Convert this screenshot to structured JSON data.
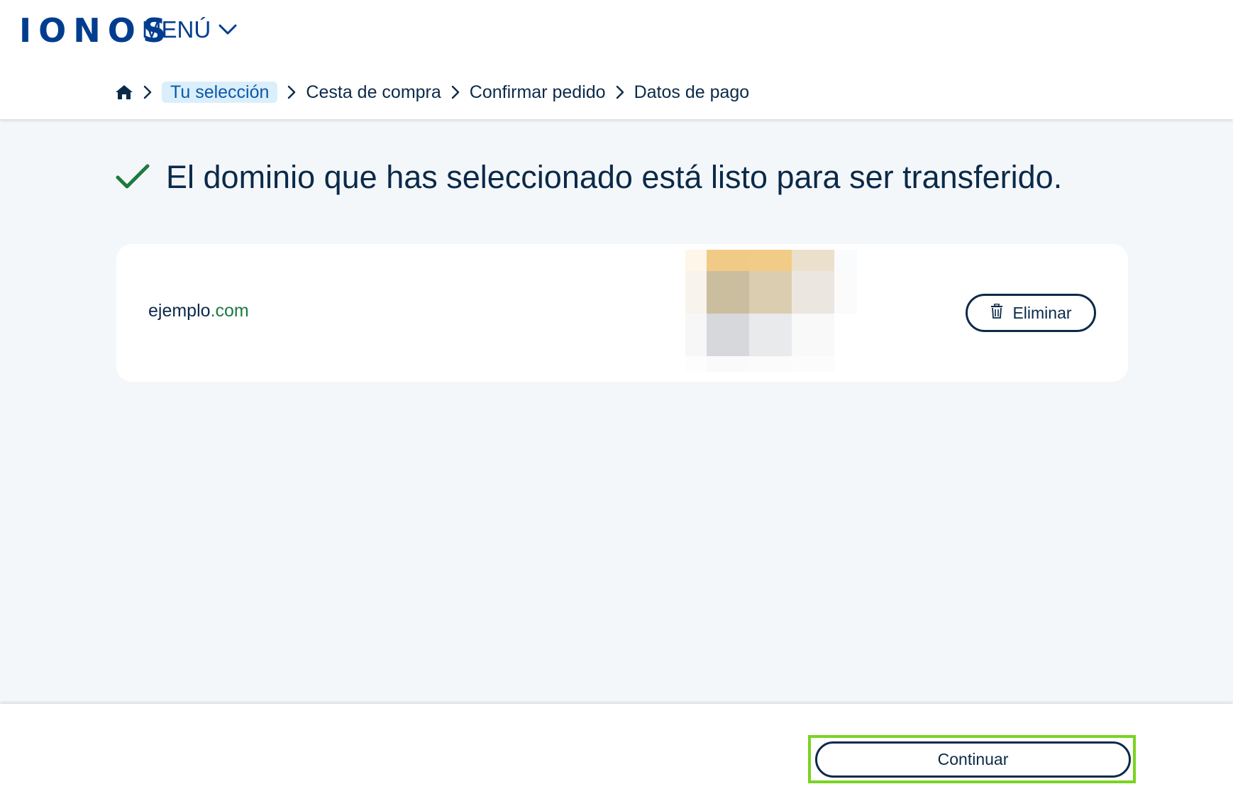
{
  "header": {
    "logo_text": "IONOS",
    "menu_label": "MENÚ",
    "menu_icon": "chevron-down-icon"
  },
  "breadcrumb": {
    "home_icon": "home-icon",
    "separator_icon": "chevron-right-icon",
    "items": [
      {
        "label": "Tu selección",
        "active": true
      },
      {
        "label": "Cesta de compra",
        "active": false
      },
      {
        "label": "Confirmar pedido",
        "active": false
      },
      {
        "label": "Datos de pago",
        "active": false
      }
    ]
  },
  "main": {
    "status_icon": "checkmark-icon",
    "heading": "El dominio que has seleccionado está listo para ser transferido."
  },
  "domain_card": {
    "domain_sld": "ejemplo",
    "domain_tld": ".com",
    "delete_icon": "trash-icon",
    "delete_label": "Eliminar"
  },
  "footer": {
    "continue_label": "Continuar"
  },
  "colors": {
    "brand_blue": "#003d8f",
    "text_dark": "#0b2a4a",
    "success_green": "#1c7a3f",
    "breadcrumb_active_bg": "#dbeefb",
    "highlight_green": "#7ad321",
    "page_background": "#f4f7fa"
  }
}
